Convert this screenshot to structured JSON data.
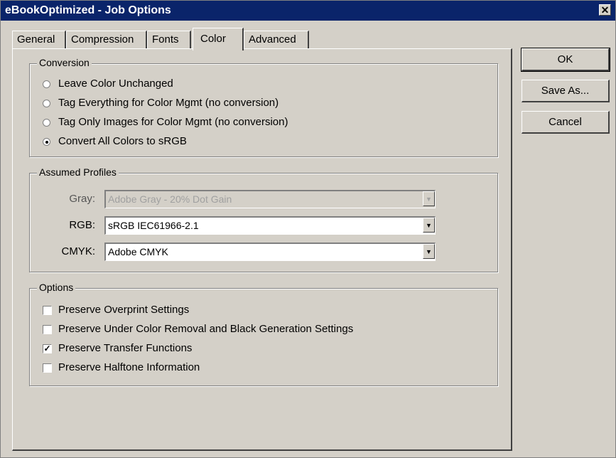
{
  "window": {
    "title": "eBookOptimized - Job Options",
    "close_glyph": "✕"
  },
  "tabs": [
    {
      "label": "General"
    },
    {
      "label": "Compression"
    },
    {
      "label": "Fonts"
    },
    {
      "label": "Color",
      "active": true
    },
    {
      "label": "Advanced"
    }
  ],
  "conversion": {
    "title": "Conversion",
    "options": [
      {
        "label": "Leave Color Unchanged",
        "selected": false
      },
      {
        "label": "Tag Everything for Color Mgmt (no conversion)",
        "selected": false
      },
      {
        "label": "Tag Only Images for Color Mgmt (no conversion)",
        "selected": false
      },
      {
        "label": "Convert All Colors to sRGB",
        "selected": true
      }
    ]
  },
  "profiles": {
    "title": "Assumed Profiles",
    "gray": {
      "label": "Gray:",
      "value": "Adobe Gray - 20% Dot Gain",
      "disabled": true
    },
    "rgb": {
      "label": "RGB:",
      "value": "sRGB IEC61966-2.1",
      "disabled": false
    },
    "cmyk": {
      "label": "CMYK:",
      "value": "Adobe CMYK",
      "disabled": false
    }
  },
  "options": {
    "title": "Options",
    "items": [
      {
        "label": "Preserve Overprint Settings",
        "checked": false
      },
      {
        "label": "Preserve Under Color Removal and Black Generation Settings",
        "checked": false
      },
      {
        "label": "Preserve Transfer Functions",
        "checked": true
      },
      {
        "label": "Preserve Halftone Information",
        "checked": false
      }
    ]
  },
  "buttons": {
    "ok": "OK",
    "save_as": "Save As...",
    "cancel": "Cancel"
  },
  "icons": {
    "radio": "radio-button",
    "checkbox": "checkbox",
    "dropdown": "chevron-down-icon",
    "close": "close-icon"
  }
}
